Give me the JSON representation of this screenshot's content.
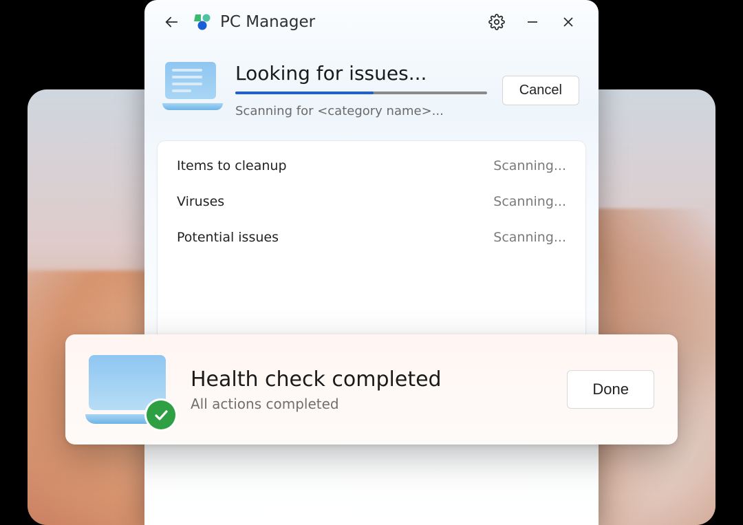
{
  "titlebar": {
    "app_name": "PC Manager"
  },
  "scan": {
    "title": "Looking for issues...",
    "subtext": "Scanning for <category name>...",
    "cancel_label": "Cancel",
    "progress_percent": 55
  },
  "results": [
    {
      "label": "Items to cleanup",
      "status": "Scanning..."
    },
    {
      "label": "Viruses",
      "status": "Scanning..."
    },
    {
      "label": "Potential issues",
      "status": "Scanning..."
    }
  ],
  "toast": {
    "title": "Health check completed",
    "subtitle": "All actions completed",
    "done_label": "Done"
  }
}
